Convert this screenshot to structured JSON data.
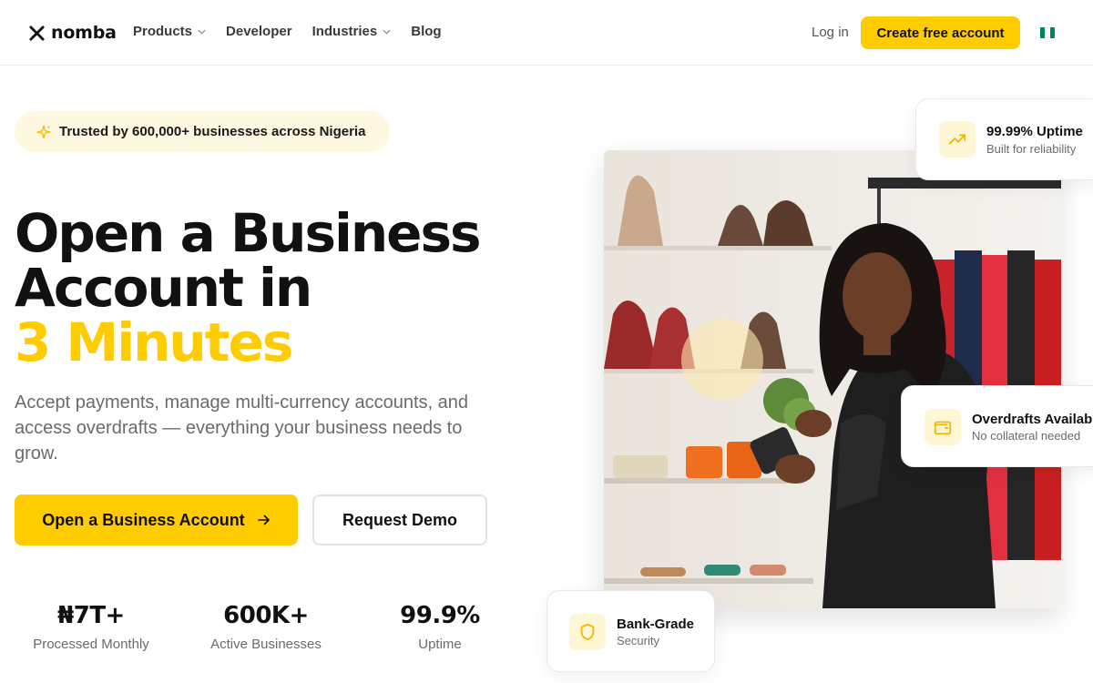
{
  "nav": {
    "logo_text": "nomba",
    "links": [
      {
        "label": "Products",
        "dropdown": true
      },
      {
        "label": "Developer",
        "dropdown": false
      },
      {
        "label": "Industries",
        "dropdown": true
      },
      {
        "label": "Blog",
        "dropdown": false
      }
    ],
    "login_label": "Log in",
    "cta_label": "Create free account",
    "flag_colors": [
      "#008751",
      "#ffffff",
      "#008751"
    ]
  },
  "hero": {
    "trust_badge": "Trusted by 600,000+ businesses across Nigeria",
    "heading_line1": "Open a Business",
    "heading_line2": "Account in",
    "heading_highlight": "3 Minutes",
    "subtitle": "Accept payments, manage multi-currency accounts, and access overdrafts — everything your business needs to grow.",
    "primary_button": "Open a Business Account",
    "secondary_button": "Request Demo"
  },
  "stats": [
    {
      "value": "₦7T+",
      "label": "Processed Monthly"
    },
    {
      "value": "600K+",
      "label": "Active Businesses"
    },
    {
      "value": "99.9%",
      "label": "Uptime"
    }
  ],
  "cards": {
    "uptime": {
      "title": "99.99% Uptime",
      "subtitle": "Built for reliability",
      "icon": "trending-up-icon"
    },
    "overdraft": {
      "title": "Overdrafts Available",
      "subtitle": "No collateral needed",
      "icon": "wallet-icon"
    },
    "security": {
      "title": "Bank-Grade",
      "subtitle": "Security",
      "icon": "shield-icon"
    }
  },
  "colors": {
    "accent": "#ffcc00",
    "accent_soft": "#fff6d6",
    "text": "#111111",
    "muted": "#6b6b6b"
  }
}
